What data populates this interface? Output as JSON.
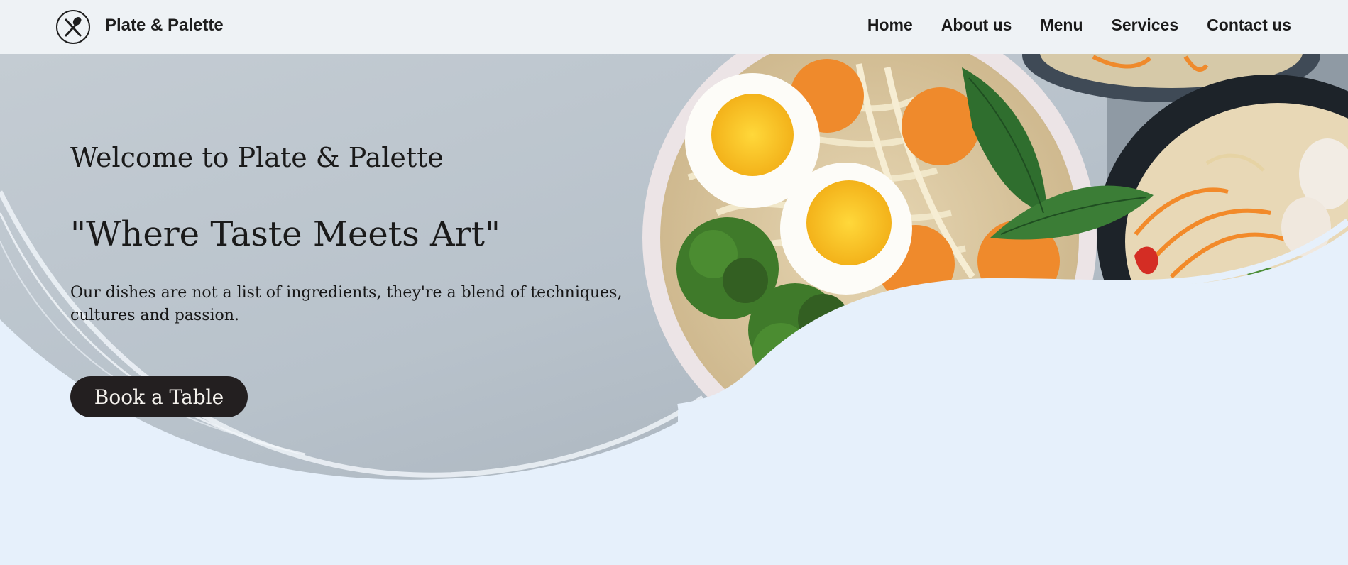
{
  "brand": {
    "name": "Plate & Palette",
    "icon": "spoon-knife-icon"
  },
  "nav": {
    "items": [
      "Home",
      "About us",
      "Menu",
      "Services",
      "Contact us"
    ]
  },
  "hero": {
    "welcome": "Welcome to Plate & Palette",
    "tagline": "\"Where Taste Meets Art\"",
    "description": "Our dishes are not a list of ingredients, they're a blend of techniques, cultures and passion.",
    "cta_label": "Book a Table",
    "image": "noodle-soup-bowls-photo"
  },
  "colors": {
    "nav_bg": "#eef2f5",
    "page_bg": "#e6f0fb",
    "button_bg": "#231f20"
  }
}
